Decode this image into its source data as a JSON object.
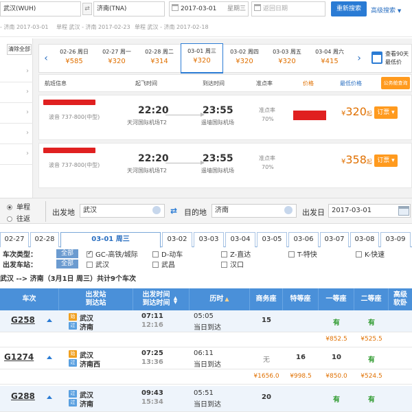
{
  "search": {
    "from": "武汉(WUH)",
    "to": "济南(TNA)",
    "date": "2017-03-01",
    "weekday": "星期三",
    "return_placeholder": "返回日期",
    "search_button": "重新搜索",
    "advanced": "高级搜索",
    "advanced_arrow": "▼",
    "swap": "⇄"
  },
  "history": [
    "- 济南 2017-03-01",
    "单程 武汉 - 济南 2017-02-23",
    "单程 武汉 - 济南 2017-02-18"
  ],
  "flight_filters": {
    "clear_all": "清除全部",
    "chevron": "›"
  },
  "date_bar": {
    "prev": "‹",
    "next": "›",
    "dates": [
      {
        "date": "02-26 周日",
        "price": "¥585"
      },
      {
        "date": "02-27 周一",
        "price": "¥320"
      },
      {
        "date": "02-28 周二",
        "price": "¥314"
      },
      {
        "date": "03-01 周三",
        "price": "¥320"
      },
      {
        "date": "03-02 周四",
        "price": "¥320"
      },
      {
        "date": "03-03 周五",
        "price": "¥320"
      },
      {
        "date": "03-04 周六",
        "price": "¥415"
      }
    ],
    "calendar_label": "查看90天最低价"
  },
  "flight_list_header": {
    "info": "航班信息",
    "depart": "起飞时间",
    "arrive": "到达时间",
    "ontime": "准点率",
    "discount": "价格",
    "lowest": "最低价格",
    "package": "公务舱查询"
  },
  "flights": [
    {
      "plane": "波音 737-800(中型)",
      "dep_time": "22:20",
      "dep_airport": "天河国际机场T2",
      "arr_time": "23:55",
      "arr_airport": "遥墙国际机场",
      "ontime_label": "准点率",
      "ontime": "70%",
      "currency": "¥",
      "price": "320",
      "price_suffix": "起",
      "book": "订票 ▾"
    },
    {
      "plane": "波音 737-800(中型)",
      "dep_time": "22:20",
      "dep_airport": "天河国际机场T2",
      "arr_time": "23:55",
      "arr_airport": "遥墙国际机场",
      "ontime_label": "准点率",
      "ontime": "70%",
      "currency": "¥",
      "price": "358",
      "price_suffix": "起",
      "book": "订票 ▾"
    }
  ],
  "train_search": {
    "one_way": "单程",
    "round_trip": "往返",
    "from_label": "出发地",
    "from_value": "武汉",
    "to_label": "目的地",
    "to_value": "济南",
    "date_label": "出发日",
    "date_value": "2017-03-01",
    "swap": "⇄"
  },
  "date_tabs": [
    {
      "label": "02-27"
    },
    {
      "label": "02-28"
    },
    {
      "label": "03-01  周三"
    },
    {
      "label": "03-02"
    },
    {
      "label": "03-03"
    },
    {
      "label": "03-04"
    },
    {
      "label": "03-05"
    },
    {
      "label": "03-06"
    },
    {
      "label": "03-07"
    },
    {
      "label": "03-08"
    },
    {
      "label": "03-09"
    }
  ],
  "filters": {
    "type_label": "车次类型：",
    "station_label": "出发车站：",
    "all": "全部",
    "types": [
      "GC-高铁/城际",
      "D-动车",
      "Z-直达",
      "T-特快",
      "K-快速"
    ],
    "stations": [
      "武汉",
      "武昌",
      "汉口"
    ]
  },
  "summary": "武汉 --> 济南（3月1日  周三）共计9个车次",
  "table_header": {
    "train": "车次",
    "stations": "出发站\n到达站",
    "times": "出发时间\n到达时间",
    "duration": "历时",
    "business": "商务座",
    "premium": "特等座",
    "first": "一等座",
    "second": "二等座",
    "soft": "高级\n软卧",
    "sort_both": "▲▼",
    "sort_up": "▲"
  },
  "trains": [
    {
      "no": "G258",
      "from_badge": "始",
      "from": "武汉",
      "to_badge": "过",
      "to": "济南",
      "dep": "07:11",
      "arr": "12:16",
      "dur": "05:05",
      "arrive_day": "当日到达",
      "business": "15",
      "premium": "",
      "first": "有",
      "second": "有",
      "price_first": "¥852.5",
      "price_second": "¥525.5",
      "price_business": "",
      "price_premium": ""
    },
    {
      "no": "G1274",
      "from_badge": "始",
      "from": "武汉",
      "to_badge": "过",
      "to": "济南西",
      "dep": "07:25",
      "arr": "13:36",
      "dur": "06:11",
      "arrive_day": "当日到达",
      "business": "无",
      "premium": "16",
      "first": "10",
      "second": "有",
      "price_business": "¥1656.0",
      "price_premium": "¥998.5",
      "price_first": "¥850.0",
      "price_second": "¥524.5"
    },
    {
      "no": "G288",
      "from_badge": "过",
      "from": "武汉",
      "to_badge": "过",
      "to": "济南",
      "dep": "09:43",
      "arr": "15:34",
      "dur": "05:51",
      "arrive_day": "当日到达",
      "business": "20",
      "premium": "",
      "first": "有",
      "second": "有"
    }
  ],
  "colors": {
    "accent": "#2a7bd4",
    "orange": "#e07000",
    "table_header": "#4a90d9",
    "green": "#2e9a2e"
  }
}
